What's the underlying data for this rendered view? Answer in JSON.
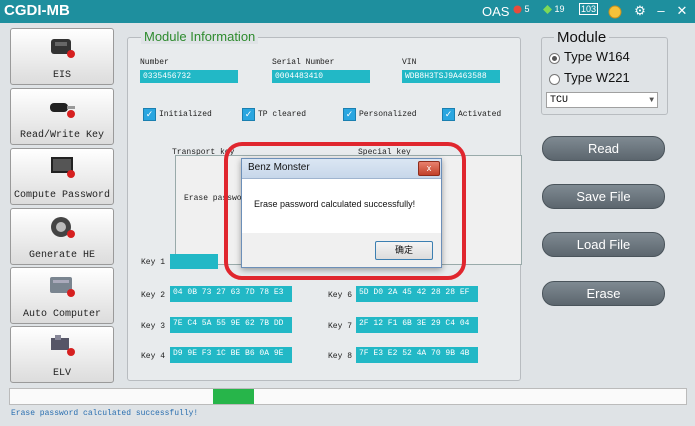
{
  "app": {
    "title": "CGDI-MB"
  },
  "titlebar": {
    "oas": "OAS",
    "stat1": "5",
    "stat2": "19",
    "stat3": "103"
  },
  "nav": [
    {
      "label": "EIS"
    },
    {
      "label": "Read/Write Key"
    },
    {
      "label": "Compute Password"
    },
    {
      "label": "Generate HE"
    },
    {
      "label": "Auto Computer"
    },
    {
      "label": "ELV"
    }
  ],
  "module_info": {
    "title": "Module Information",
    "number_label": "Number",
    "number_value": "0335456732",
    "serial_label": "Serial Number",
    "serial_value": "0004483410",
    "vin_label": "VIN",
    "vin_value": "WDB8H3TSJ9A463588",
    "checks": [
      {
        "label": "Initialized",
        "checked": true
      },
      {
        "label": "TP cleared",
        "checked": true
      },
      {
        "label": "Personalized",
        "checked": true
      },
      {
        "label": "Activated",
        "checked": true
      }
    ],
    "transport_key_label": "Transport key",
    "special_key_label": "Special key",
    "erase_password_label": "Erase passwo"
  },
  "keys": [
    {
      "label": "Key 1",
      "value": ""
    },
    {
      "label": "Key 2",
      "value": "04 0B 73 27 63 7D 78 E3"
    },
    {
      "label": "Key 3",
      "value": "7E C4 5A 55 9E 62 7B DD"
    },
    {
      "label": "Key 4",
      "value": "D9 9E F3 1C BE B6 0A 9E"
    },
    {
      "label": "Key 6",
      "value": "5D D0 2A 45 42 28 28 EF"
    },
    {
      "label": "Key 7",
      "value": "2F 12 F1 6B 3E 29 C4 04"
    },
    {
      "label": "Key 8",
      "value": "7F E3 E2 52 4A 70 9B 4B"
    }
  ],
  "module_panel": {
    "legend": "Module",
    "options": [
      {
        "label": "Type W164",
        "selected": true
      },
      {
        "label": "Type W221",
        "selected": false
      }
    ],
    "select_value": "TCU"
  },
  "actions": [
    {
      "label": "Read"
    },
    {
      "label": "Save File"
    },
    {
      "label": "Load File"
    },
    {
      "label": "Erase"
    }
  ],
  "progress": {
    "start_fraction": 0.3,
    "fill_fraction": 0.06
  },
  "status": {
    "text": "Erase password calculated successfully!"
  },
  "dialog": {
    "title": "Benz Monster",
    "close_glyph": "x",
    "message": "Erase password calculated successfully!",
    "ok_label": "确定"
  },
  "colors": {
    "accent": "#1e8f9e",
    "field": "#22b8c6",
    "progress": "#27b54a",
    "highlight": "#e0262e"
  }
}
